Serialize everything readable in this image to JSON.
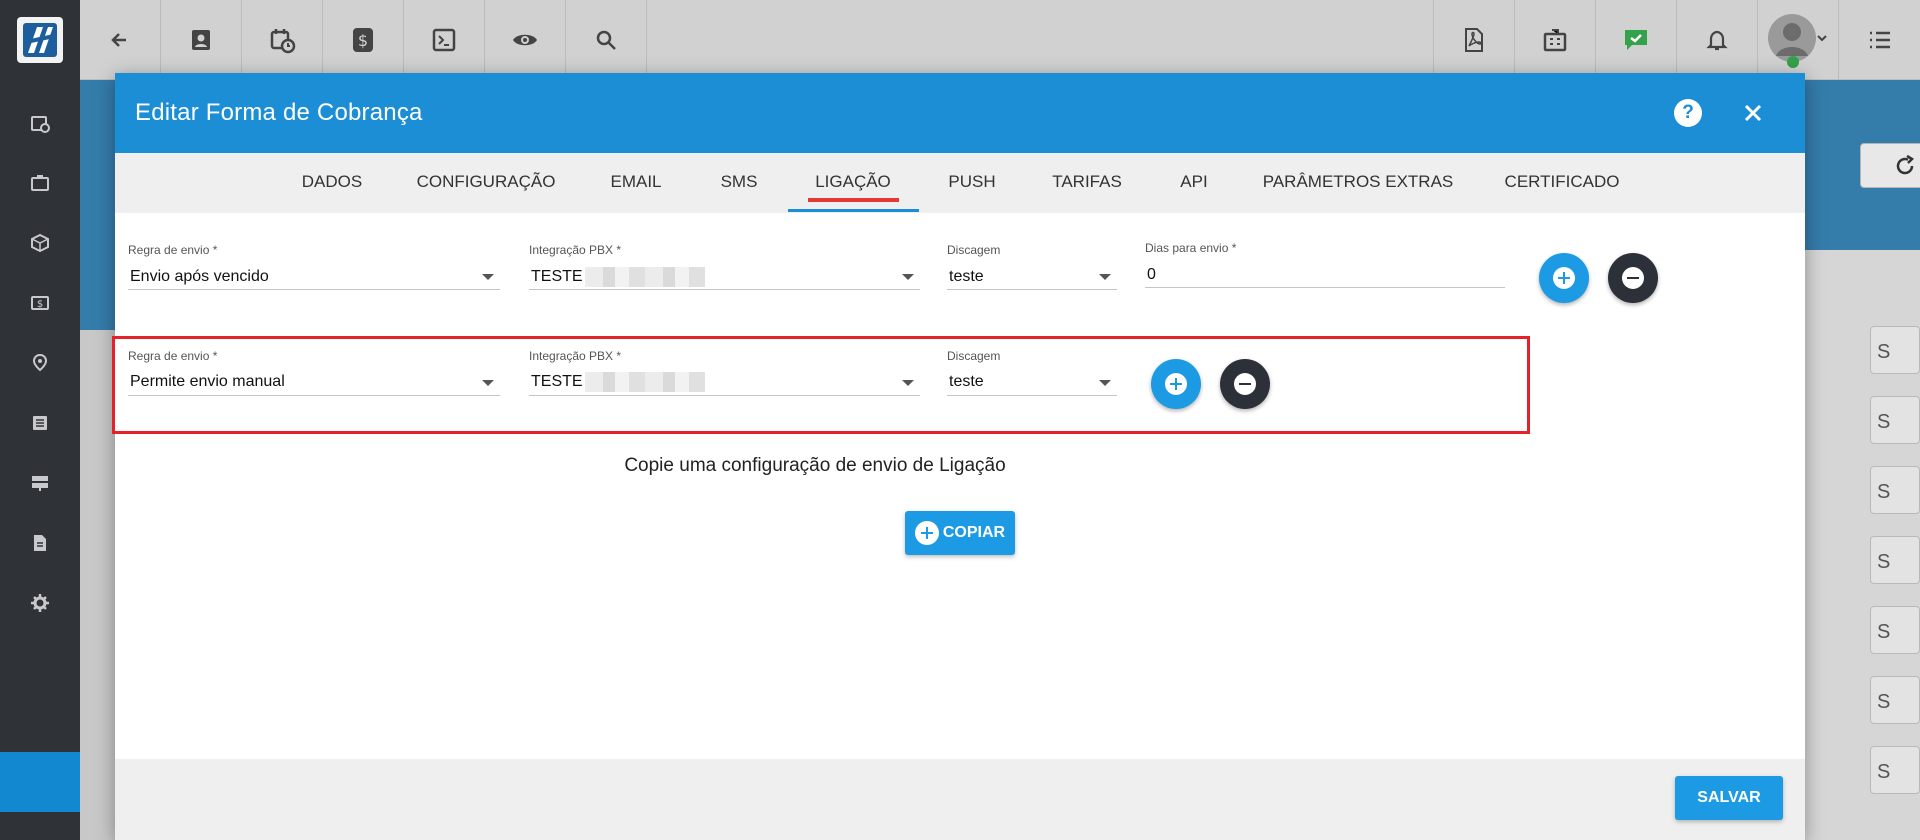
{
  "modal": {
    "title": "Editar Forma de Cobrança",
    "help_label": "?",
    "tabs": [
      {
        "label": "DADOS"
      },
      {
        "label": "CONFIGURAÇÃO"
      },
      {
        "label": "EMAIL"
      },
      {
        "label": "SMS"
      },
      {
        "label": "LIGAÇÃO",
        "active": true
      },
      {
        "label": "PUSH"
      },
      {
        "label": "TARIFAS"
      },
      {
        "label": "API"
      },
      {
        "label": "PARÂMETROS EXTRAS"
      },
      {
        "label": "CERTIFICADO"
      }
    ],
    "rows": [
      {
        "regra_label": "Regra de envio *",
        "regra_value": "Envio após vencido",
        "integracao_label": "Integração PBX *",
        "integracao_value": "TESTE",
        "discagem_label": "Discagem",
        "discagem_value": "teste",
        "dias_label": "Dias para envio *",
        "dias_value": "0"
      },
      {
        "regra_label": "Regra de envio *",
        "regra_value": "Permite envio manual",
        "integracao_label": "Integração PBX *",
        "integracao_value": "TESTE",
        "discagem_label": "Discagem",
        "discagem_value": "teste"
      }
    ],
    "copy_text": "Copie uma configuração de envio de Ligação",
    "copy_button": "COPIAR",
    "save_button": "SALVAR"
  },
  "background": {
    "button_fragments": [
      "S",
      "S",
      "S",
      "S",
      "S",
      "S",
      "S"
    ]
  },
  "colors": {
    "primary": "#1c8ed6",
    "highlight": "#e3222a",
    "sidebar": "#2f3237"
  },
  "icons": {
    "topbar": [
      "back-arrow-icon",
      "contact-icon",
      "calendar-clock-icon",
      "dollar-icon",
      "terminal-icon",
      "eye-icon",
      "search-icon",
      "pdf-icon",
      "building-icon",
      "chat-check-icon",
      "bell-icon",
      "avatar",
      "list-icon"
    ],
    "sidebar": [
      "calendar-icon",
      "briefcase-icon",
      "box-icon",
      "money-icon",
      "map-pin-icon",
      "list-icon",
      "server-icon",
      "document-icon",
      "gear-icon"
    ]
  }
}
